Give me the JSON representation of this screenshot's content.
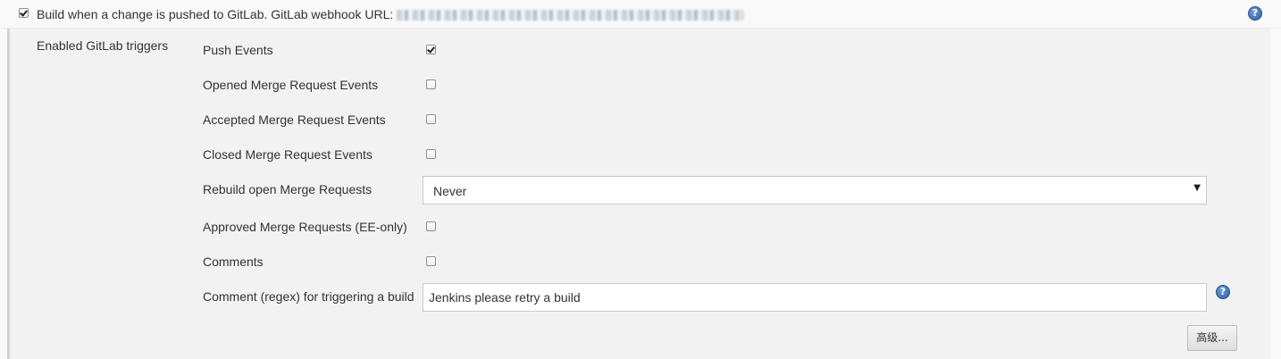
{
  "trigger": {
    "checked": true,
    "label": "Build when a change is pushed to GitLab. GitLab webhook URL:"
  },
  "section_label": "Enabled GitLab triggers",
  "rows": [
    {
      "label": "Push Events",
      "checked": true
    },
    {
      "label": "Opened Merge Request Events",
      "checked": false
    },
    {
      "label": "Accepted Merge Request Events",
      "checked": false
    },
    {
      "label": "Closed Merge Request Events",
      "checked": false
    },
    {
      "label": "Rebuild open Merge Requests",
      "value": "Never"
    },
    {
      "label": "Approved Merge Requests (EE-only)",
      "checked": false
    },
    {
      "label": "Comments",
      "checked": false
    },
    {
      "label": "Comment (regex) for triggering a build",
      "value": "Jenkins please retry a build"
    }
  ],
  "icons": {
    "help": "help-icon",
    "help_glyph": "?",
    "select_arrow": "▼"
  },
  "advanced_button": "高级..."
}
